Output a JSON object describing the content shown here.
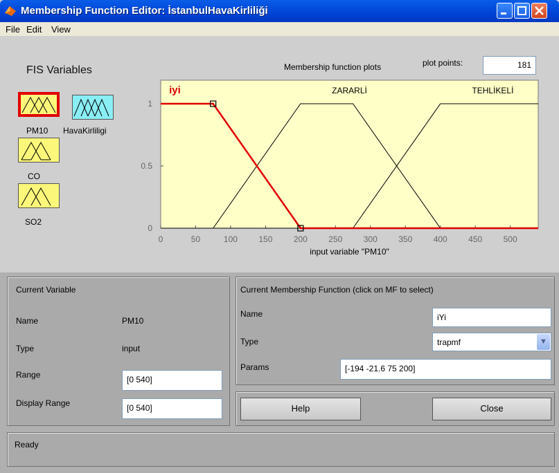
{
  "window": {
    "title": "Membership Function Editor: İstanbulHavaKirliliği"
  },
  "menu": [
    "File",
    "Edit",
    "View"
  ],
  "fis": {
    "heading": "FIS Variables",
    "variables": [
      {
        "label": "PM10",
        "kind": "input",
        "selected": true
      },
      {
        "label": "HavaKirliligi",
        "kind": "output",
        "selected": false
      },
      {
        "label": "CO",
        "kind": "input",
        "selected": false
      },
      {
        "label": "SO2",
        "kind": "input",
        "selected": false
      }
    ]
  },
  "plot": {
    "title": "Membership function plots",
    "plot_points_label": "plot points:",
    "plot_points_value": "181",
    "xlabel": "input variable \"PM10\"",
    "x_ticks": [
      "0",
      "50",
      "100",
      "150",
      "200",
      "250",
      "300",
      "350",
      "400",
      "450",
      "500"
    ],
    "y_ticks": [
      "0",
      "0.5",
      "1"
    ]
  },
  "chart_data": {
    "type": "line",
    "xlim": [
      0,
      540
    ],
    "ylim": [
      0,
      1
    ],
    "xlabel": "input variable \"PM10\"",
    "series": [
      {
        "name": "iyi",
        "label": "iyi",
        "color": "#e00000",
        "selected": true,
        "x": [
          0,
          75,
          200,
          540
        ],
        "y": [
          1,
          1,
          0,
          0
        ]
      },
      {
        "name": "ZARARLI",
        "label": "ZARARLİ",
        "color": "#000000",
        "selected": false,
        "x": [
          0,
          75,
          200,
          275,
          400,
          540
        ],
        "y": [
          0,
          0,
          1,
          1,
          0,
          0
        ]
      },
      {
        "name": "TEHLIKELI",
        "label": "TEHLİKELİ",
        "color": "#000000",
        "selected": false,
        "x": [
          0,
          275,
          400,
          540
        ],
        "y": [
          0,
          0,
          1,
          1
        ]
      }
    ]
  },
  "current_variable": {
    "heading": "Current Variable",
    "name_label": "Name",
    "name_value": "PM10",
    "type_label": "Type",
    "type_value": "input",
    "range_label": "Range",
    "range_value": "[0 540]",
    "display_range_label": "Display Range",
    "display_range_value": "[0 540]"
  },
  "current_mf": {
    "heading": "Current Membership Function (click on MF to select)",
    "name_label": "Name",
    "name_value": "iYi",
    "type_label": "Type",
    "type_value": "trapmf",
    "params_label": "Params",
    "params_value": "[-194 -21.6 75 200]"
  },
  "buttons": {
    "help": "Help",
    "close": "Close"
  },
  "status": "Ready",
  "colors": {
    "plot_bg": "#ffffc8",
    "selected": "#e00000",
    "titlebar": "#0054e3"
  }
}
